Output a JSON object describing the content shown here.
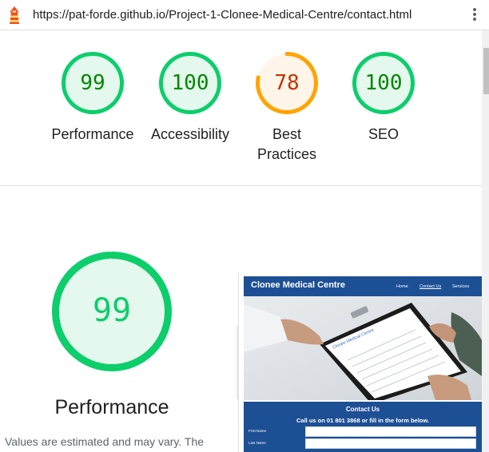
{
  "browser": {
    "url": "https://pat-forde.github.io/Project-1-Clonee-Medical-Centre/contact.html"
  },
  "scores": [
    {
      "label": "Performance",
      "value": "99",
      "fraction": 0.99,
      "color": "#0cce6b",
      "text_color": "#008800",
      "fill": "#e5f8ee"
    },
    {
      "label": "Accessibility",
      "value": "100",
      "fraction": 1.0,
      "color": "#0cce6b",
      "text_color": "#008800",
      "fill": "#e5f8ee"
    },
    {
      "label": "Best Practices",
      "value": "78",
      "fraction": 0.78,
      "color": "#ffa400",
      "text_color": "#c33300",
      "fill": "#fff5e8"
    },
    {
      "label": "SEO",
      "value": "100",
      "fraction": 1.0,
      "color": "#0cce6b",
      "text_color": "#008800",
      "fill": "#e5f8ee"
    }
  ],
  "detail": {
    "score": "99",
    "fraction": 0.99,
    "title": "Performance",
    "note": "Values are estimated and may vary. The"
  },
  "site_preview": {
    "brand": "Clonee Medical Centre",
    "nav": [
      "Home",
      "Contact Us",
      "Services"
    ],
    "contact_title": "Contact Us",
    "contact_sub": "Call us on 01 801 3868 or fill in the form below.",
    "field_labels": [
      "First Name",
      "Last Name"
    ],
    "clipboard_text": "Clonee Medical Centre"
  },
  "colors": {
    "pass": "#0cce6b",
    "average": "#ffa400",
    "site_blue": "#1d4f94"
  }
}
